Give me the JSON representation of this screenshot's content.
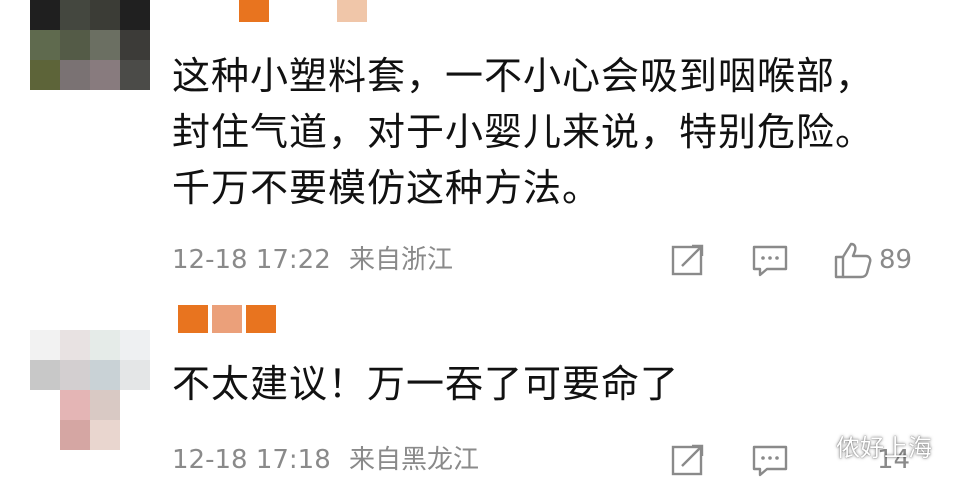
{
  "comments": [
    {
      "text": "这种小塑料套，一不小心会吸到咽喉部，封住气道，对于小婴儿来说，特别危险。千万不要模仿这种方法。",
      "date": "12-18 17:22",
      "location": "来自浙江",
      "likes": "89"
    },
    {
      "text": "不太建议！万一吞了可要命了",
      "date": "12-18 17:18",
      "location": "来自黑龙江",
      "likes": "14"
    }
  ],
  "icons": {
    "forward": "share-forward-icon",
    "reply": "comment-bubble-icon",
    "like": "thumbs-up-icon"
  },
  "watermark": {
    "text": "侬好上海",
    "icon": "wechat-icon"
  },
  "colors": {
    "text": "#111111",
    "meta": "#8a8a8a",
    "username_blur": "#e8741f"
  }
}
